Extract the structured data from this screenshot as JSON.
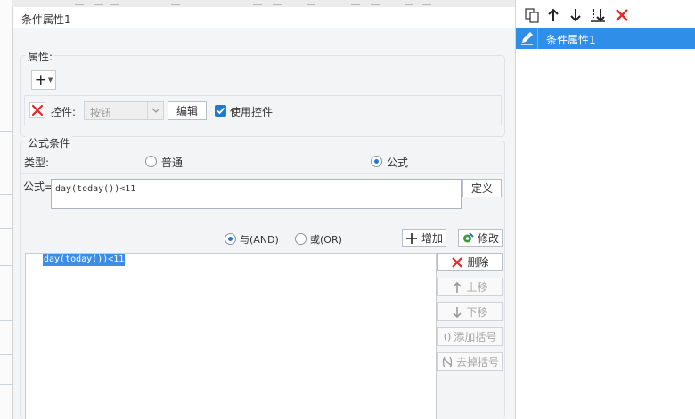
{
  "dialog": {
    "title": "条件属性1",
    "properties": {
      "legend": "属性:",
      "add_symbol": "+",
      "control_label": "控件:",
      "control_select_value": "按钮",
      "edit_button": "编辑",
      "use_control_label": "使用控件",
      "use_control_checked": true
    },
    "formula_condition": {
      "legend": "公式条件",
      "type_label": "类型:",
      "type_options": [
        "普通",
        "公式"
      ],
      "type_selected": "公式",
      "formula_label": "公式=",
      "formula_value": "day(today())<11",
      "define_button": "定义",
      "logic_options": [
        "与(AND)",
        "或(OR)"
      ],
      "logic_selected": "与(AND)",
      "add_button": "增加",
      "modify_button": "修改",
      "conditions": [
        "day(today())<11"
      ],
      "delete_button": "删除",
      "move_up_button": "上移",
      "move_down_button": "下移",
      "add_bracket_button": "添加括号",
      "remove_bracket_button": "去掉括号"
    }
  },
  "right_panel": {
    "items": [
      "条件属性1"
    ],
    "selected_index": 0
  },
  "colors": {
    "accent": "#2f8fe8",
    "checkbox": "#1e7bd0",
    "delete_red": "#e02b2b"
  }
}
